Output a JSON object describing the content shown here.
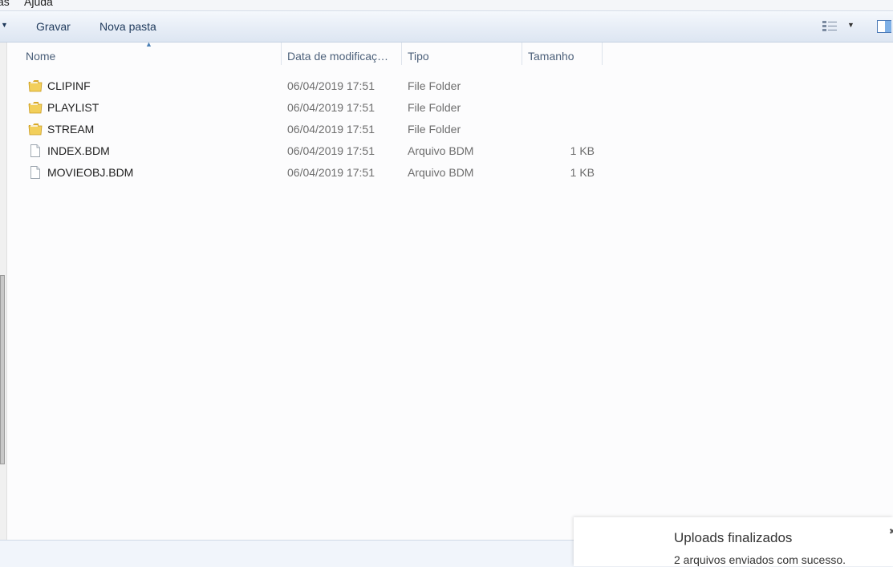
{
  "menu": {
    "items": [
      "as",
      "Ajuda"
    ]
  },
  "toolbar": {
    "burn_label": "Gravar",
    "new_folder_label": "Nova pasta",
    "dropdown_arrow": "▼",
    "view_dropdown_arrow": "▼"
  },
  "columns": {
    "name": "Nome",
    "date": "Data de modificaç…",
    "type": "Tipo",
    "size": "Tamanho",
    "sort_indicator": "▲"
  },
  "files": [
    {
      "name": "CLIPINF",
      "date": "06/04/2019 17:51",
      "type": "File Folder",
      "size": "",
      "icon": "folder-icon"
    },
    {
      "name": "PLAYLIST",
      "date": "06/04/2019 17:51",
      "type": "File Folder",
      "size": "",
      "icon": "folder-icon"
    },
    {
      "name": "STREAM",
      "date": "06/04/2019 17:51",
      "type": "File Folder",
      "size": "",
      "icon": "folder-icon"
    },
    {
      "name": "INDEX.BDM",
      "date": "06/04/2019 17:51",
      "type": "Arquivo BDM",
      "size": "1 KB",
      "icon": "file-icon"
    },
    {
      "name": "MOVIEOBJ.BDM",
      "date": "06/04/2019 17:51",
      "type": "Arquivo BDM",
      "size": "1 KB",
      "icon": "file-icon"
    }
  ],
  "toast": {
    "title": "Uploads finalizados",
    "message": "2 arquivos enviados com sucesso.",
    "close_glyph": "✖"
  },
  "colors": {
    "folder": "#e8c04a",
    "toolbar_text": "#1e395b",
    "header_text": "#4c607a",
    "secondary_text": "#6d6d6d"
  }
}
